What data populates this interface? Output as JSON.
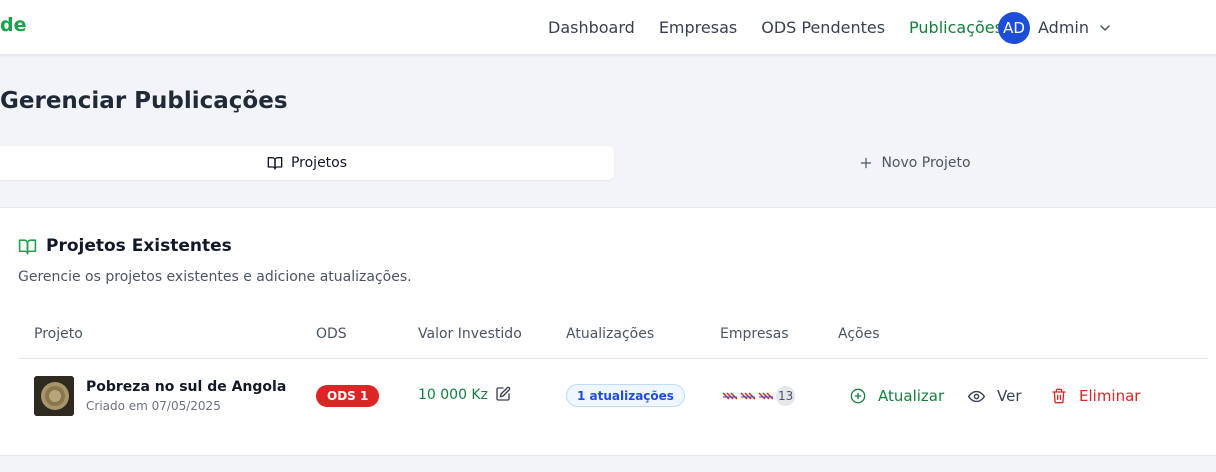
{
  "header": {
    "brand": "de",
    "nav": [
      {
        "label": "Dashboard",
        "active": false
      },
      {
        "label": "Empresas",
        "active": false
      },
      {
        "label": "ODS Pendentes",
        "active": false
      },
      {
        "label": "Publicações",
        "active": true
      }
    ],
    "user": {
      "initials": "AD",
      "name": "Admin"
    }
  },
  "page": {
    "title": "Gerenciar Publicações"
  },
  "tabs": [
    {
      "label": "Projetos",
      "icon": "book-open-icon",
      "active": true
    },
    {
      "label": "Novo Projeto",
      "icon": "plus-icon",
      "active": false
    }
  ],
  "card": {
    "title": "Projetos Existentes",
    "description": "Gerencie os projetos existentes e adicione atualizações.",
    "columns": [
      "Projeto",
      "ODS",
      "Valor Investido",
      "Atualizações",
      "Empresas",
      "Ações"
    ],
    "rows": [
      {
        "name": "Pobreza no sul de Angola",
        "created": "Criado em 07/05/2025",
        "ods": "ODS 1",
        "valor": "10 000 Kz",
        "updates": "1 atualizações",
        "companies_count": "13",
        "actions": {
          "update": "Atualizar",
          "view": "Ver",
          "delete": "Eliminar"
        }
      }
    ]
  },
  "colors": {
    "accent_green": "#15803d",
    "danger_red": "#dc2626",
    "avatar_blue": "#1d4ed8",
    "badge_blue": "#1d4ed8"
  }
}
